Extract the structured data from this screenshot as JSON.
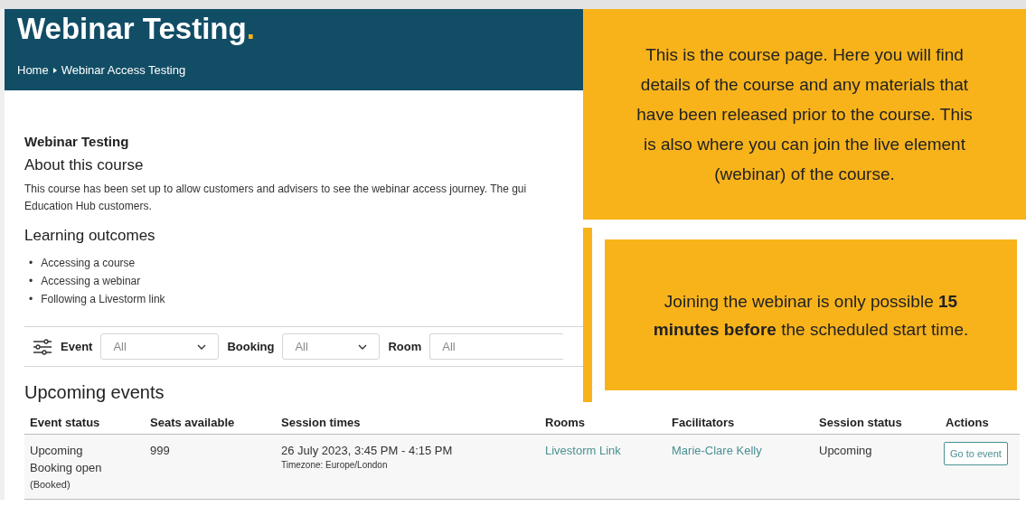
{
  "header": {
    "title": "Webinar Testing",
    "title_dot": ".",
    "breadcrumb": [
      {
        "label": "Home"
      },
      {
        "label": "Webinar Access Testing"
      }
    ]
  },
  "course": {
    "name": "Webinar Testing",
    "about_heading": "About this course",
    "description_lines": [
      "This course has been set up to allow customers and advisers to see the webinar access journey. The gui",
      "Education Hub customers."
    ],
    "outcomes_heading": "Learning outcomes",
    "outcome_marker": "•",
    "outcomes": [
      "Accessing a course",
      "Accessing a webinar",
      "Following a Livestorm link"
    ]
  },
  "filters": [
    {
      "label": "Event",
      "value": "All",
      "kind": "dropdown"
    },
    {
      "label": "Booking",
      "value": "All",
      "kind": "dropdown"
    },
    {
      "label": "Room",
      "value": "All",
      "kind": "text"
    }
  ],
  "events": {
    "heading": "Upcoming events",
    "columns": [
      "Event status",
      "Seats available",
      "Session times",
      "Rooms",
      "Facilitators",
      "Session status",
      "Actions"
    ],
    "rows": [
      {
        "event_status": [
          "Upcoming",
          "Booking open"
        ],
        "booked": "(Booked)",
        "seats": "999",
        "time": "26 July 2023, 3:45 PM - 4:15 PM",
        "timezone": "Timezone: Europe/London",
        "room": "Livestorm Link",
        "facilitator": "Marie-Clare Kelly",
        "session_status": "Upcoming",
        "action": "Go to event"
      }
    ]
  },
  "callouts": [
    {
      "text": "This is the course page. Here you will find details of the course and any materials that have been released prior to the course. This is also where you can join the live element (webinar) of the course."
    },
    {
      "text": "Joining the webinar is only possible **15 minutes before** the scheduled start time."
    }
  ]
}
